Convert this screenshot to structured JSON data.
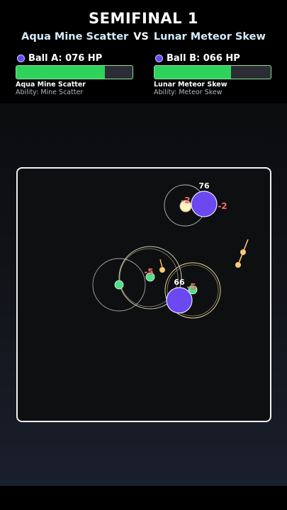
{
  "header": {
    "title": "SEMIFINAL 1",
    "left_name": "Aqua Mine Scatter",
    "vs": "VS",
    "right_name": "Lunar Meteor Skew"
  },
  "ball_a": {
    "hp_label": "Ball A: 076 HP",
    "hp": 76,
    "hp_max": 100,
    "name": "Aqua Mine Scatter",
    "ability": "Ability: Mine Scatter",
    "color": "#6b48f0",
    "bar_color": "#2ed35c"
  },
  "ball_b": {
    "hp_label": "Ball B: 066 HP",
    "hp": 66,
    "hp_max": 100,
    "name": "Lunar Meteor Skew",
    "ability": "Ability: Meteor Skew",
    "color": "#6b48f0",
    "bar_color": "#2ed35c"
  },
  "arena": {
    "ball_a_hp_text": "76",
    "ball_b_hp_text": "66",
    "damage_popups": [
      "-2",
      "-2",
      "-5",
      "-5"
    ],
    "colors": {
      "ball": "#6b48f0",
      "mine": "#4fe088",
      "meteor": "#f9c87a",
      "damage": "#f06a6a",
      "ring": "#d8d8d8"
    }
  }
}
